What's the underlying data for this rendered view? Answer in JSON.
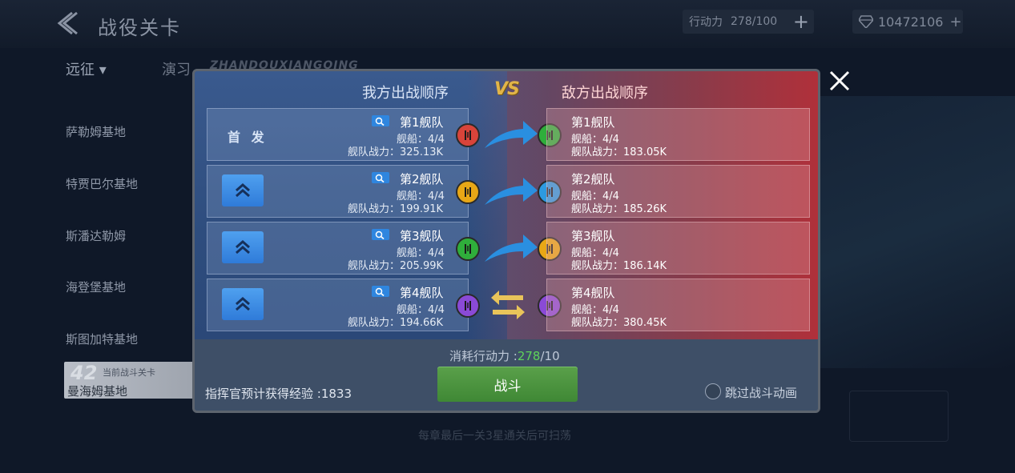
{
  "topbar": {
    "title": "战役关卡",
    "action_points_label": "行动力",
    "action_points_value": "278/100",
    "diamonds": "10472106"
  },
  "tabs": {
    "active": "远征 ▾",
    "other": "演习"
  },
  "watermark": "ZHANDOUXIANGQING",
  "sidebar": {
    "items": [
      "萨勒姆基地",
      "特贾巴尔基地",
      "斯潘达勒姆",
      "海登堡基地",
      "斯图加特基地"
    ],
    "current_stage_number": "42",
    "current_stage_label": "当前战斗关卡",
    "current_stage_name": "曼海姆基地"
  },
  "bottom_hint": "每章最后一关3星通关后可扫荡",
  "dialog": {
    "ally_header": "我方出战顺序",
    "vs": "VS",
    "enemy_header": "敌方出战顺序",
    "first_label": "首 发",
    "ally_fleets": [
      {
        "name": "第1舰队",
        "ships": "舰船：4/4",
        "power": "舰队战力：325.13K",
        "badge_color": "#d8443a"
      },
      {
        "name": "第2舰队",
        "ships": "舰船：4/4",
        "power": "舰队战力：199.91K",
        "badge_color": "#e8a716"
      },
      {
        "name": "第3舰队",
        "ships": "舰船：4/4",
        "power": "舰队战力：205.99K",
        "badge_color": "#2fae3b"
      },
      {
        "name": "第4舰队",
        "ships": "舰船：4/4",
        "power": "舰队战力：194.66K",
        "badge_color": "#8a4ad6"
      }
    ],
    "enemy_fleets": [
      {
        "name": "第1舰队",
        "ships": "舰船：4/4",
        "power": "舰队战力：183.05K",
        "badge_color": "#2fae3b"
      },
      {
        "name": "第2舰队",
        "ships": "舰船：4/4",
        "power": "舰队战力：185.26K",
        "badge_color": "#2d9ae0"
      },
      {
        "name": "第3舰队",
        "ships": "舰船：4/4",
        "power": "舰队战力：186.14K",
        "badge_color": "#e8a716"
      },
      {
        "name": "第4舰队",
        "ships": "舰船：4/4",
        "power": "舰队战力：380.45K",
        "badge_color": "#8a4ad6"
      }
    ],
    "cost_label": "消耗行动力 :",
    "cost_current": "278",
    "cost_total": "/10",
    "battle_button": "战斗",
    "exp_text": "指挥官预计获得经验  :1833",
    "skip_label": "跳过战斗动画"
  }
}
